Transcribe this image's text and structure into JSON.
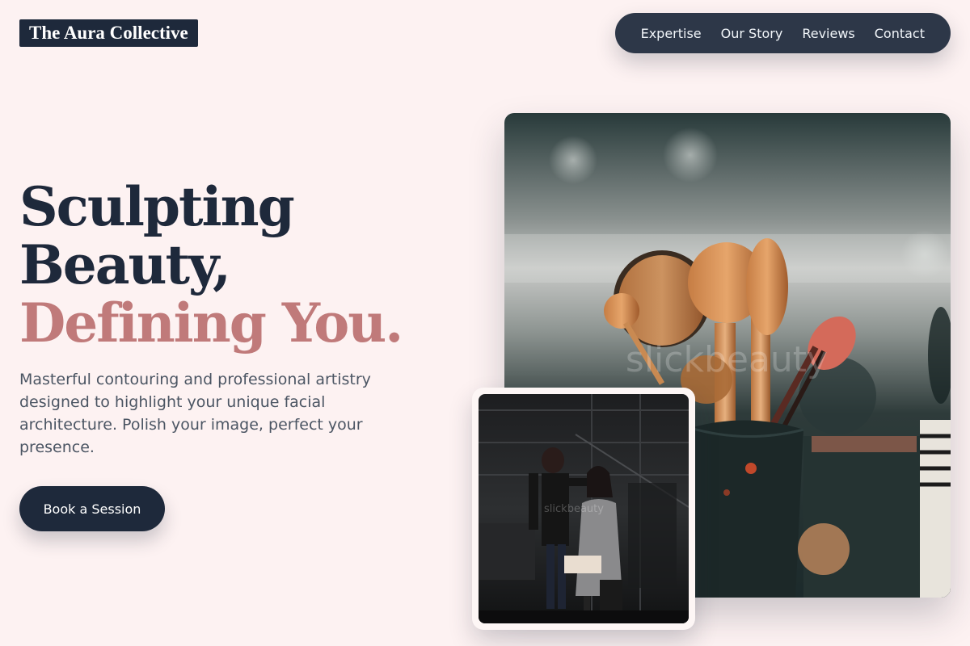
{
  "brand": {
    "name": "The Aura Collective"
  },
  "nav": {
    "items": [
      {
        "label": "Expertise"
      },
      {
        "label": "Our Story"
      },
      {
        "label": "Reviews"
      },
      {
        "label": "Contact"
      }
    ]
  },
  "hero": {
    "headline_line1": "Sculpting",
    "headline_line2": "Beauty,",
    "headline_line3": "Defining You.",
    "description": "Masterful contouring and professional artistry designed to highlight your unique facial architecture. Polish your image, perfect your presence.",
    "cta_label": "Book a Session"
  },
  "images": {
    "main_watermark": "slickbeauty",
    "small_watermark": "slickbeauty"
  },
  "colors": {
    "background": "#fdf2f2",
    "navy": "#1e293b",
    "nav_background": "#2d3748",
    "accent_rose": "#c07a7a",
    "body_text": "#4b5563"
  }
}
